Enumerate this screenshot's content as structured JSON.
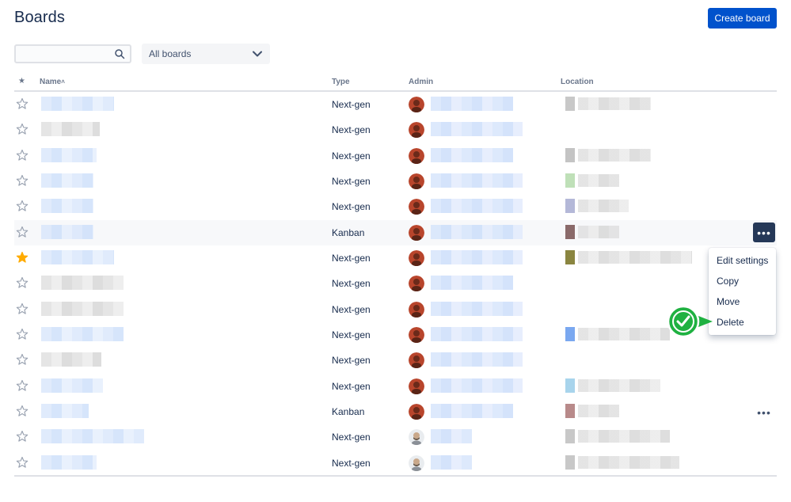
{
  "header": {
    "title": "Boards",
    "create_button": "Create board"
  },
  "filters": {
    "search_placeholder": "",
    "board_filter": "All boards"
  },
  "table": {
    "columns": {
      "star": "★",
      "name": "Name",
      "name_sort": "˄",
      "type": "Type",
      "admin": "Admin",
      "location": "Location"
    },
    "rows": [
      {
        "type": "Next-gen",
        "starred": false
      },
      {
        "type": "Next-gen",
        "starred": false
      },
      {
        "type": "Next-gen",
        "starred": false
      },
      {
        "type": "Next-gen",
        "starred": false
      },
      {
        "type": "Next-gen",
        "starred": false
      },
      {
        "type": "Kanban",
        "starred": false
      },
      {
        "type": "Next-gen",
        "starred": true
      },
      {
        "type": "Next-gen",
        "starred": false
      },
      {
        "type": "Next-gen",
        "starred": false
      },
      {
        "type": "Next-gen",
        "starred": false
      },
      {
        "type": "Next-gen",
        "starred": false
      },
      {
        "type": "Next-gen",
        "starred": false
      },
      {
        "type": "Kanban",
        "starred": false
      },
      {
        "type": "Next-gen",
        "starred": false
      },
      {
        "type": "Next-gen",
        "starred": false
      }
    ]
  },
  "more_actions": {
    "label": "•••"
  },
  "menu": {
    "items": [
      "Edit settings",
      "Copy",
      "Move",
      "Delete"
    ]
  },
  "colors": {
    "primary": "#0052cc",
    "star_active": "#ffab00",
    "check_marker": "#1fb141"
  }
}
